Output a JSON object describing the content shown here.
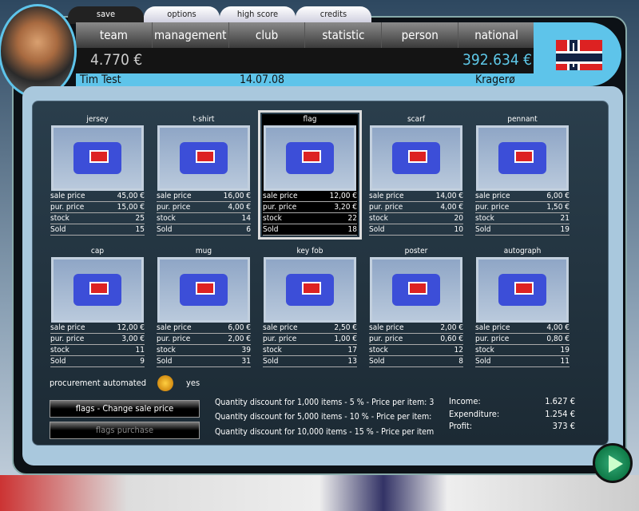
{
  "top_tabs": [
    "save",
    "options",
    "high score",
    "credits"
  ],
  "nav": [
    "team",
    "management",
    "club",
    "statistic",
    "person",
    "national"
  ],
  "header": {
    "cash": "4.770 €",
    "budget": "392.634 €",
    "manager": "Tim Test",
    "date": "14.07.08",
    "city": "Kragerø"
  },
  "row_labels": {
    "sale": "sale price",
    "pur": "pur. price",
    "stock": "stock",
    "sold": "Sold"
  },
  "items": [
    {
      "name": "jersey",
      "sale": "45,00 €",
      "pur": "15,00 €",
      "stock": "25",
      "sold": "15"
    },
    {
      "name": "t-shirt",
      "sale": "16,00 €",
      "pur": "4,00 €",
      "stock": "14",
      "sold": "6"
    },
    {
      "name": "flag",
      "sale": "12,00 €",
      "pur": "3,20 €",
      "stock": "22",
      "sold": "18",
      "selected": true
    },
    {
      "name": "scarf",
      "sale": "14,00 €",
      "pur": "4,00 €",
      "stock": "20",
      "sold": "10"
    },
    {
      "name": "pennant",
      "sale": "6,00 €",
      "pur": "1,50 €",
      "stock": "21",
      "sold": "19"
    },
    {
      "name": "cap",
      "sale": "12,00 €",
      "pur": "3,00 €",
      "stock": "11",
      "sold": "9"
    },
    {
      "name": "mug",
      "sale": "6,00 €",
      "pur": "2,00 €",
      "stock": "39",
      "sold": "31"
    },
    {
      "name": "key fob",
      "sale": "2,50 €",
      "pur": "1,00 €",
      "stock": "17",
      "sold": "13"
    },
    {
      "name": "poster",
      "sale": "2,00 €",
      "pur": "0,60 €",
      "stock": "12",
      "sold": "8"
    },
    {
      "name": "autograph",
      "sale": "4,00 €",
      "pur": "0,80 €",
      "stock": "19",
      "sold": "11"
    }
  ],
  "procurement": {
    "label": "procurement automated",
    "value": "yes"
  },
  "buttons": {
    "change": "flags - Change sale price",
    "purchase": "flags purchase"
  },
  "discounts": [
    "Quantity discount for 1,000 items - 5 % - Price per item: 3",
    "Quantity discount for 5,000 items - 10 % - Price per item:",
    "Quantity discount for 10,000 items - 15 % - Price per item"
  ],
  "finance": [
    {
      "label": "Income:",
      "value": "1.627 €"
    },
    {
      "label": "Expenditure:",
      "value": "1.254 €"
    },
    {
      "label": "Profit:",
      "value": "373 €"
    }
  ],
  "colors": {
    "accent": "#5ec4ea",
    "budget": "#5ec8e8"
  }
}
